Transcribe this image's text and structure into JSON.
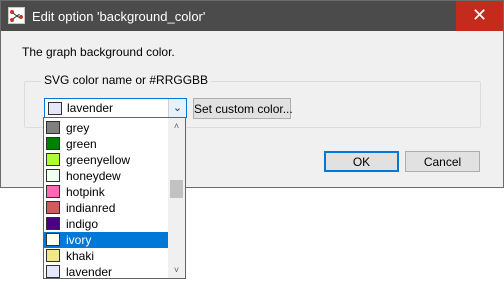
{
  "window": {
    "title": "Edit option 'background_color'",
    "close_glyph": "✕",
    "app_icon": "graph-app-icon"
  },
  "description": "The graph background color.",
  "group": {
    "label": "SVG color name or #RRGGBB"
  },
  "combo": {
    "value": "lavender",
    "swatch_color": "#e6e6fa",
    "arrow_glyph": "⌄"
  },
  "buttons": {
    "custom_color": "Set custom color...",
    "ok": "OK",
    "cancel": "Cancel"
  },
  "dropdown": {
    "items": [
      {
        "label": "grey",
        "color": "#808080"
      },
      {
        "label": "green",
        "color": "#008000"
      },
      {
        "label": "greenyellow",
        "color": "#adff2f"
      },
      {
        "label": "honeydew",
        "color": "#f0fff0"
      },
      {
        "label": "hotpink",
        "color": "#ff69b4"
      },
      {
        "label": "indianred",
        "color": "#cd5c5c"
      },
      {
        "label": "indigo",
        "color": "#4b0082"
      },
      {
        "label": "ivory",
        "color": "#fffff0",
        "selected": true
      },
      {
        "label": "khaki",
        "color": "#f0e68c"
      },
      {
        "label": "lavender",
        "color": "#e6e6fa"
      }
    ],
    "scroll_up_glyph": "˄",
    "scroll_down_glyph": "˅"
  },
  "colors": {
    "titlebar": "#4b4b4b",
    "close_button": "#c42b1c",
    "selection": "#0078d7",
    "dialog_bg": "#f0f0f0"
  }
}
